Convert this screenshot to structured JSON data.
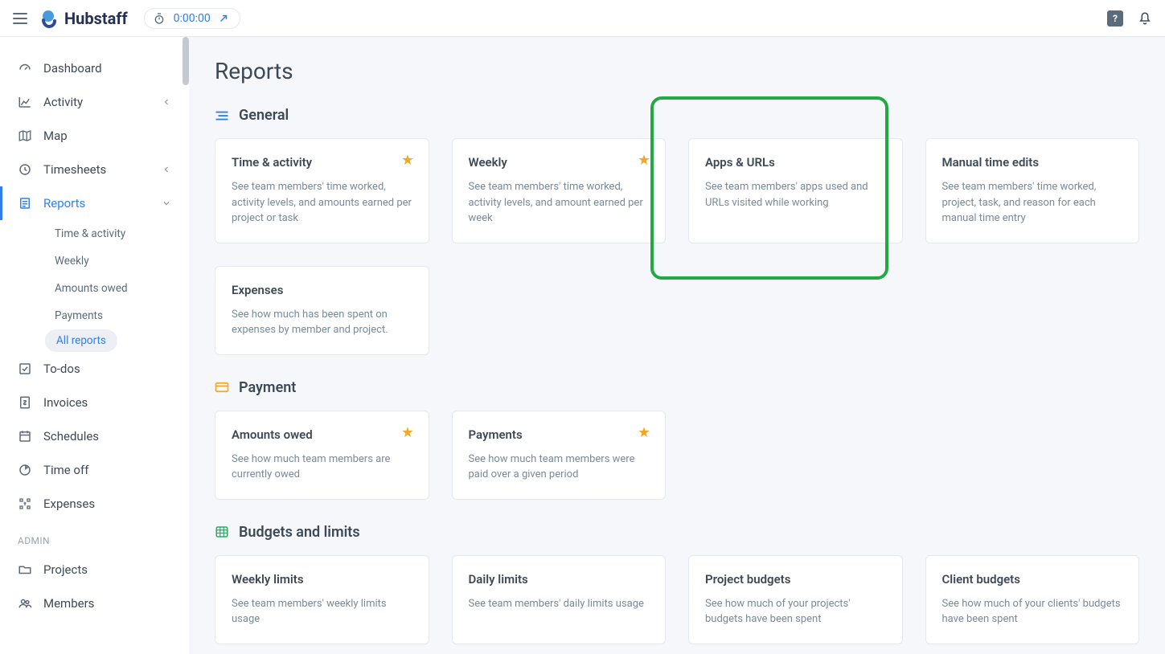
{
  "brand": "Hubstaff",
  "timer": {
    "value": "0:00:00"
  },
  "help": "?",
  "sidebar": {
    "items": [
      {
        "label": "Dashboard"
      },
      {
        "label": "Activity"
      },
      {
        "label": "Map"
      },
      {
        "label": "Timesheets"
      },
      {
        "label": "Reports"
      },
      {
        "label": "To-dos"
      },
      {
        "label": "Invoices"
      },
      {
        "label": "Schedules"
      },
      {
        "label": "Time off"
      },
      {
        "label": "Expenses"
      },
      {
        "label": "Projects"
      },
      {
        "label": "Members"
      }
    ],
    "reports_sub": [
      {
        "label": "Time & activity"
      },
      {
        "label": "Weekly"
      },
      {
        "label": "Amounts owed"
      },
      {
        "label": "Payments"
      },
      {
        "label": "All reports"
      }
    ],
    "admin_label": "ADMIN"
  },
  "page": {
    "title": "Reports"
  },
  "sections": {
    "general": {
      "title": "General",
      "cards": [
        {
          "title": "Time & activity",
          "desc": "See team members' time worked, activity levels, and amounts earned per project or task",
          "starred": true
        },
        {
          "title": "Weekly",
          "desc": "See team members' time worked, activity levels, and amount earned per week",
          "starred": true
        },
        {
          "title": "Apps & URLs",
          "desc": "See team members' apps used and URLs visited while working",
          "starred": false
        },
        {
          "title": "Manual time edits",
          "desc": "See team members' time worked, project, task, and reason for each manual time entry",
          "starred": false
        },
        {
          "title": "Expenses",
          "desc": "See how much has been spent on expenses by member and project.",
          "starred": false
        }
      ]
    },
    "payment": {
      "title": "Payment",
      "cards": [
        {
          "title": "Amounts owed",
          "desc": "See how much team members are currently owed",
          "starred": true
        },
        {
          "title": "Payments",
          "desc": "See how much team members were paid over a given period",
          "starred": true
        }
      ]
    },
    "budgets": {
      "title": "Budgets and limits",
      "cards": [
        {
          "title": "Weekly limits",
          "desc": "See team members' weekly limits usage"
        },
        {
          "title": "Daily limits",
          "desc": "See team members' daily limits usage"
        },
        {
          "title": "Project budgets",
          "desc": "See how much of your projects' budgets have been spent"
        },
        {
          "title": "Client budgets",
          "desc": "See how much of your clients' budgets have been spent"
        }
      ]
    }
  }
}
